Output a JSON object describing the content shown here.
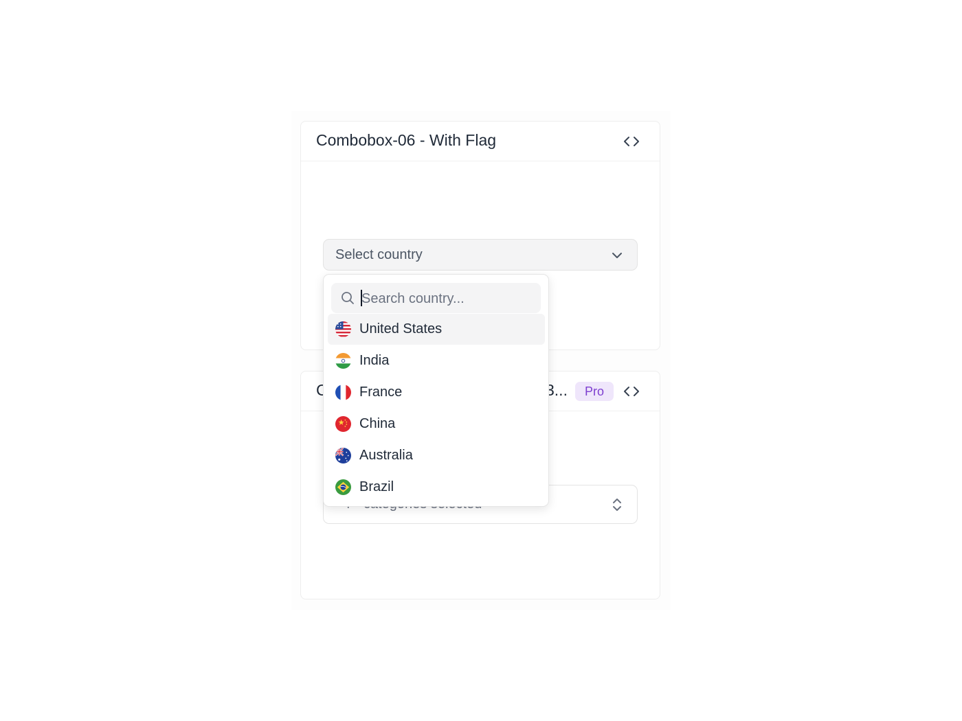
{
  "card1": {
    "title": "Combobox-06 - With Flag",
    "select": {
      "placeholder": "Select country"
    }
  },
  "card2": {
    "title_left_fragment": "C",
    "title_right_fragment": "3...",
    "badge": "Pro",
    "multi": {
      "count": "4",
      "summary": "categories selected"
    }
  },
  "popover": {
    "search_placeholder": "Search country...",
    "options": [
      {
        "label": "United States",
        "flag": "us-flag-icon",
        "active": true
      },
      {
        "label": "India",
        "flag": "india-flag-icon",
        "active": false
      },
      {
        "label": "France",
        "flag": "france-flag-icon",
        "active": false
      },
      {
        "label": "China",
        "flag": "china-flag-icon",
        "active": false
      },
      {
        "label": "Australia",
        "flag": "australia-flag-icon",
        "active": false
      },
      {
        "label": "Brazil",
        "flag": "brazil-flag-icon",
        "active": false
      }
    ]
  },
  "colors": {
    "badge_bg": "#efe6fb",
    "badge_text": "#7e3fd0",
    "active_option_bg": "#f4f4f5"
  }
}
